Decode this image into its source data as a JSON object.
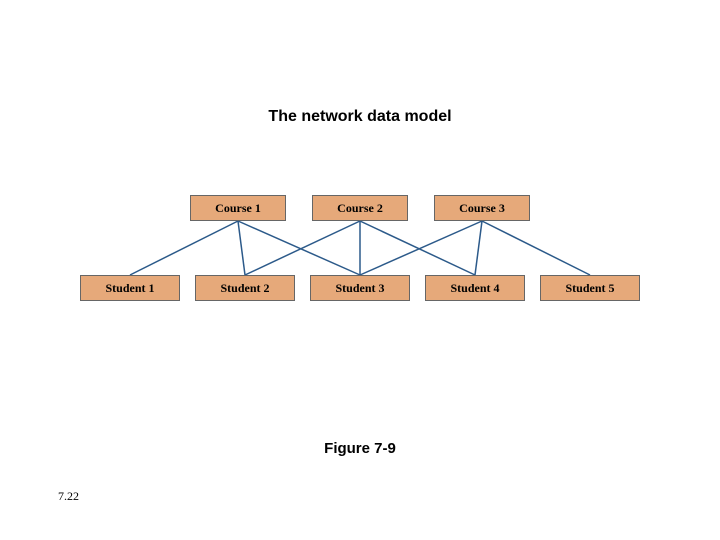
{
  "title": "The network data model",
  "figure_label": "Figure 7-9",
  "page_number": "7.22",
  "courses": [
    {
      "label": "Course 1"
    },
    {
      "label": "Course 2"
    },
    {
      "label": "Course 3"
    }
  ],
  "students": [
    {
      "label": "Student 1"
    },
    {
      "label": "Student 2"
    },
    {
      "label": "Student 3"
    },
    {
      "label": "Student 4"
    },
    {
      "label": "Student 5"
    }
  ],
  "connections": [
    {
      "from_course": 0,
      "to_student": 0
    },
    {
      "from_course": 0,
      "to_student": 1
    },
    {
      "from_course": 0,
      "to_student": 2
    },
    {
      "from_course": 1,
      "to_student": 1
    },
    {
      "from_course": 1,
      "to_student": 2
    },
    {
      "from_course": 1,
      "to_student": 3
    },
    {
      "from_course": 2,
      "to_student": 2
    },
    {
      "from_course": 2,
      "to_student": 3
    },
    {
      "from_course": 2,
      "to_student": 4
    }
  ],
  "colors": {
    "box_fill": "#e6a97a",
    "line_color": "#2c5a8a"
  }
}
